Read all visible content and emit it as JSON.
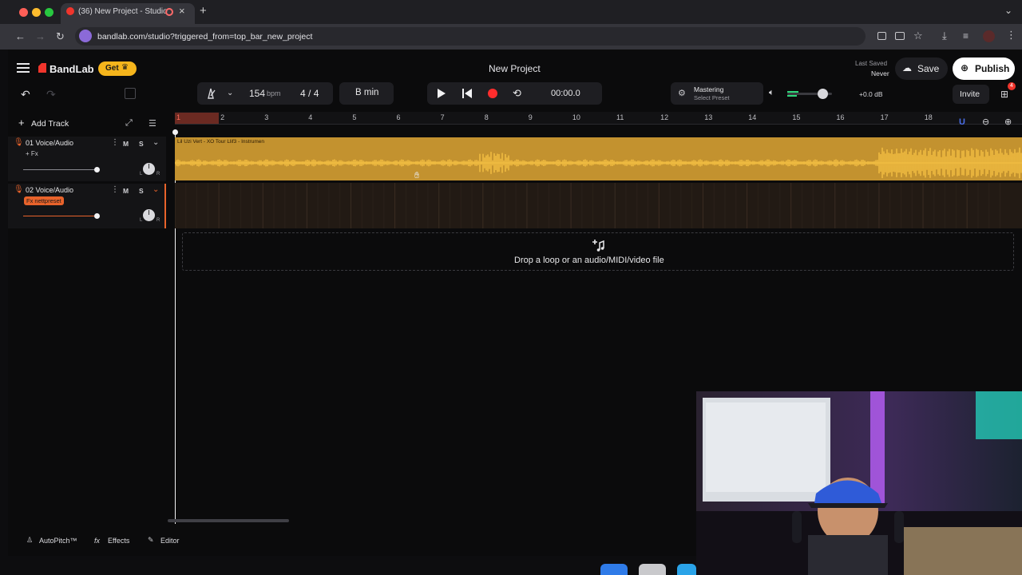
{
  "browser": {
    "tab_title": "(36) New Project - Studio",
    "url": "bandlab.com/studio?triggered_from=top_bar_new_project"
  },
  "header": {
    "brand": "BandLab",
    "get_label": "Get",
    "project_title": "New Project",
    "last_saved_label": "Last Saved",
    "last_saved_value": "Never",
    "save_label": "Save",
    "publish_label": "Publish"
  },
  "transport": {
    "bpm_value": "154",
    "bpm_unit": "bpm",
    "time_sig_num": "4",
    "time_sig_sep": "/",
    "time_sig_den": "4",
    "key": "B min",
    "time": "00:00.0",
    "mastering_label": "Mastering",
    "select_preset": "Select Preset",
    "db_value": "+0.0 dB",
    "invite_label": "Invite",
    "notification_count": "4"
  },
  "toolbar": {
    "add_track": "Add Track"
  },
  "ruler": {
    "bars": [
      "1",
      "2",
      "3",
      "4",
      "5",
      "6",
      "7",
      "8",
      "9",
      "10",
      "11",
      "12",
      "13",
      "14",
      "15",
      "16",
      "17",
      "18"
    ]
  },
  "tracks": [
    {
      "name": "01  Voice/Audio",
      "fx": "+ Fx",
      "mute": "M",
      "solo": "S",
      "region_title": "Lil Uzi Vert - XO Tour Llif3 - Instrumen",
      "volume": 0.79
    },
    {
      "name": "02  Voice/Audio",
      "fx": "Fx nettpreset",
      "mute": "M",
      "solo": "S",
      "volume": 0.79
    }
  ],
  "dropzone": {
    "text": "Drop a loop or an audio/MIDI/video file"
  },
  "bottom": {
    "autopitch": "AutoPitch™",
    "effects": "Effects",
    "editor": "Editor"
  },
  "colors": {
    "accent_orange": "#e8632b",
    "region_gold": "#c3922f",
    "waveform": "#f6c143",
    "record_red": "#ff2d2d",
    "bandlab_red": "#f0352c",
    "get_yellow": "#f5b51c"
  }
}
